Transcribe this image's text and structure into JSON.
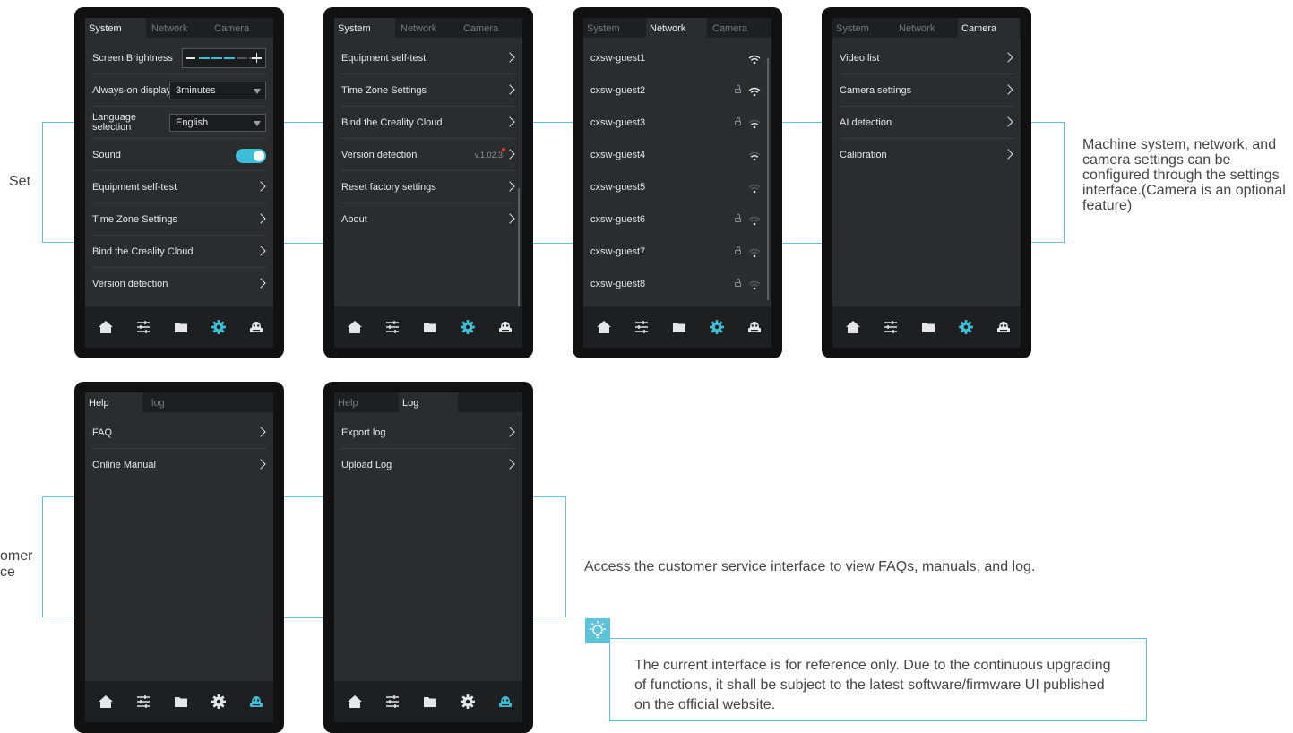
{
  "labels": {
    "set": "Set",
    "customer_partial": "omer\nce"
  },
  "captions": {
    "settings": "Machine system, network, and camera settings can be configured through the settings interface.(Camera is an optional feature)",
    "customer": "Access the customer service interface to view FAQs, manuals, and log."
  },
  "note": {
    "text": "The current interface is for reference only. Due to the continuous upgrading of functions, it shall be subject to the latest software/firmware UI published on the official website.",
    "icon": "lightbulb-icon"
  },
  "colors": {
    "accent": "#3cbed6",
    "screen_bg": "#2b2c2e",
    "frame": "#111111",
    "connector": "#5cc3d8"
  },
  "navbar": {
    "items": [
      "home-icon",
      "sliders-icon",
      "folder-icon",
      "gear-icon",
      "robot-icon"
    ]
  },
  "screens": {
    "s1": {
      "tabs": [
        "System",
        "Network",
        "Camera"
      ],
      "active_tab": "System",
      "rows": {
        "brightness": {
          "label": "Screen Brightness",
          "level": 0.6
        },
        "always_on": {
          "label": "Always-on display",
          "value": "3minutes"
        },
        "language": {
          "label": "Language selection",
          "value": "English"
        },
        "sound": {
          "label": "Sound",
          "on": true
        },
        "self_test": "Equipment self-test",
        "time_zone": "Time Zone Settings",
        "bind_cloud": "Bind the Creality Cloud",
        "version": "Version detection"
      },
      "active_nav": "gear-icon"
    },
    "s2": {
      "tabs": [
        "System",
        "Network",
        "Camera"
      ],
      "active_tab": "System",
      "rows": [
        "Equipment self-test",
        "Time Zone Settings",
        "Bind the Creality Cloud",
        "Version detection",
        "Reset factory settings",
        "About"
      ],
      "version": "v.1.02.3",
      "active_nav": "gear-icon"
    },
    "s3": {
      "tabs": [
        "System",
        "Network",
        "Camera"
      ],
      "active_tab": "Network",
      "networks": [
        {
          "ssid": "cxsw-guest1",
          "locked": false,
          "signal": 3
        },
        {
          "ssid": "cxsw-guest2",
          "locked": true,
          "signal": 3
        },
        {
          "ssid": "cxsw-guest3",
          "locked": true,
          "signal": 2
        },
        {
          "ssid": "cxsw-guest4",
          "locked": false,
          "signal": 2
        },
        {
          "ssid": "cxsw-guest5",
          "locked": false,
          "signal": 1
        },
        {
          "ssid": "cxsw-guest6",
          "locked": true,
          "signal": 1
        },
        {
          "ssid": "cxsw-guest7",
          "locked": true,
          "signal": 1
        },
        {
          "ssid": "cxsw-guest8",
          "locked": true,
          "signal": 1
        }
      ],
      "active_nav": "gear-icon"
    },
    "s4": {
      "tabs": [
        "System",
        "Network",
        "Camera"
      ],
      "active_tab": "Camera",
      "rows": [
        "Video list",
        "Camera settings",
        "AI detection",
        "Calibration"
      ],
      "active_nav": "gear-icon"
    },
    "s5": {
      "tabs": [
        "Help",
        "log"
      ],
      "active_tab": "Help",
      "rows": [
        "FAQ",
        "Online Manual"
      ],
      "active_nav": "robot-icon"
    },
    "s6": {
      "tabs": [
        "Help",
        "Log"
      ],
      "active_tab": "Log",
      "rows": [
        "Export log",
        "Upload Log"
      ],
      "active_nav": "robot-icon"
    }
  }
}
